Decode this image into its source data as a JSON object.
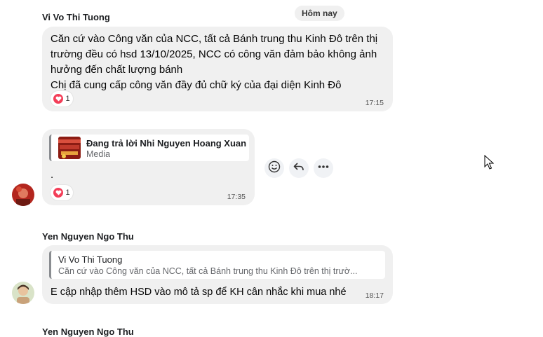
{
  "date_separator": "Hôm nay",
  "messages": [
    {
      "sender": "Vi Vo Thi Tuong",
      "lines": [
        "Căn cứ vào Công văn của NCC, tất cả Bánh trung thu Kinh Đô trên thị",
        "trường đều có hsd 13/10/2025, NCC có công văn đảm bảo không ảnh",
        "hưởng đến chất lượng bánh",
        "Chị đã cung cấp công văn đầy đủ chữ ký của đại diện Kinh Đô"
      ],
      "reaction_count": "1",
      "time": "17:15"
    },
    {
      "reply_title": "Đang trả lời Nhi Nguyen Hoang Xuan",
      "reply_sub": "Media",
      "text": ".",
      "reaction_count": "1",
      "time": "17:35"
    },
    {
      "sender": "Yen Nguyen Ngo Thu",
      "reply_title": "Vi Vo Thi Tuong",
      "reply_sub": "Căn cứ vào Công văn của NCC, tất cả Bánh trung thu Kinh Đô trên thị trườ...",
      "text": "E cập nhập thêm HSD vào mô tả sp để KH cân nhắc khi mua nhé",
      "time": "18:17"
    }
  ],
  "next_sender": "Yen Nguyen Ngo Thu",
  "colors": {
    "bubble": "#f0f0f0",
    "heart": "#f33e58",
    "background": "#ffffff"
  },
  "icons": [
    "smile-icon",
    "reply-icon",
    "more-icon",
    "heart-icon",
    "cursor-icon"
  ]
}
